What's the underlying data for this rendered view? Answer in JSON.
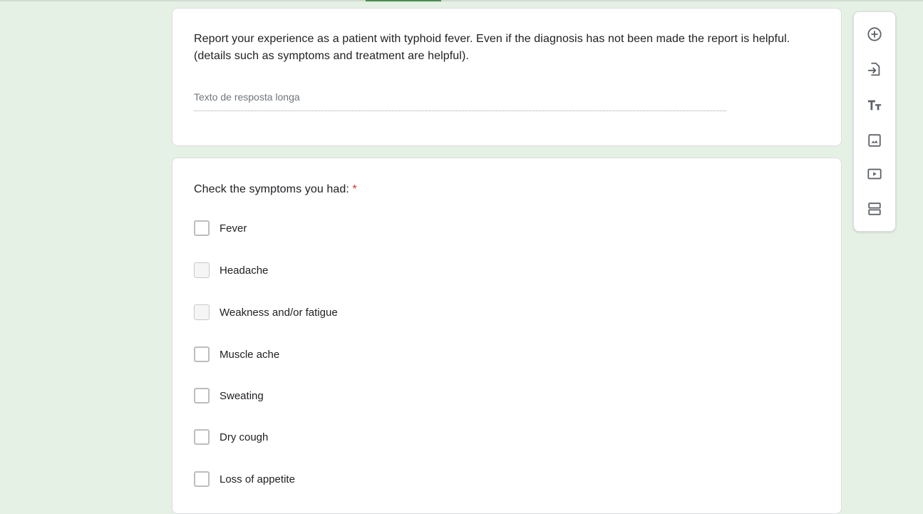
{
  "question_paragraph": {
    "title": "Report your experience as a patient with typhoid fever. Even if the diagnosis has not been made the report is helpful. (details such as symptoms and treatment are helpful).",
    "answer_placeholder": "Texto de resposta longa"
  },
  "question_checkboxes": {
    "title": "Check the symptoms you had: ",
    "required_marker": "*",
    "options": [
      {
        "label": "Fever"
      },
      {
        "label": "Headache"
      },
      {
        "label": "Weakness and/or fatigue"
      },
      {
        "label": "Muscle ache"
      },
      {
        "label": "Sweating"
      },
      {
        "label": "Dry cough"
      },
      {
        "label": "Loss of appetite"
      }
    ]
  },
  "sidebar": {
    "tools": [
      {
        "icon": "add-circle-icon"
      },
      {
        "icon": "import-questions-icon"
      },
      {
        "icon": "title-text-icon"
      },
      {
        "icon": "image-icon"
      },
      {
        "icon": "video-icon"
      },
      {
        "icon": "section-icon"
      }
    ]
  },
  "colors": {
    "page_background": "#e6f1e5",
    "required_star": "#d93025",
    "accent": "#4a8c52"
  }
}
